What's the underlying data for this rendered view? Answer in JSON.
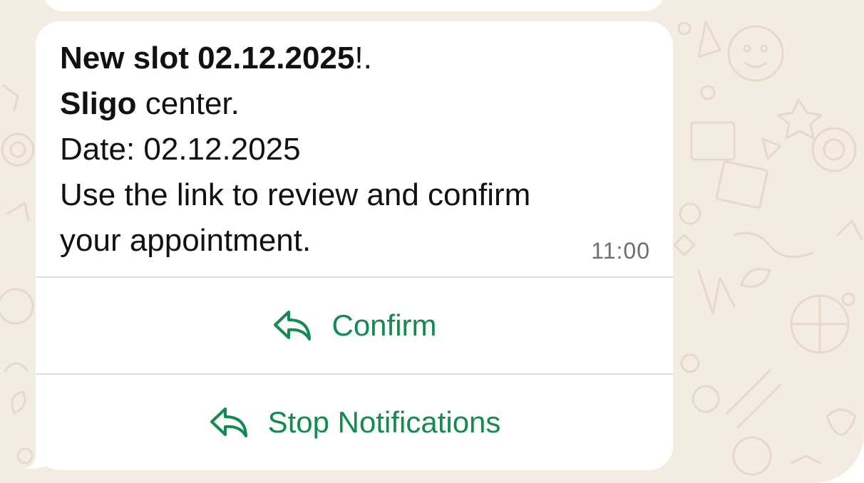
{
  "message": {
    "line1_bold": "New slot 02.12.2025",
    "line1_rest": "!.",
    "line2_bold": "Sligo",
    "line2_rest": " center.",
    "line3": "Date: 02.12.2025",
    "line4": "Use the link to review and confirm",
    "line5": "your appointment.",
    "time": "11:00"
  },
  "actions": [
    {
      "label": "Confirm",
      "icon": "reply-icon"
    },
    {
      "label": "Stop Notifications",
      "icon": "reply-icon"
    }
  ],
  "colors": {
    "accent": "#138a50",
    "chat_background": "#f3ece3",
    "bubble": "#ffffff"
  }
}
